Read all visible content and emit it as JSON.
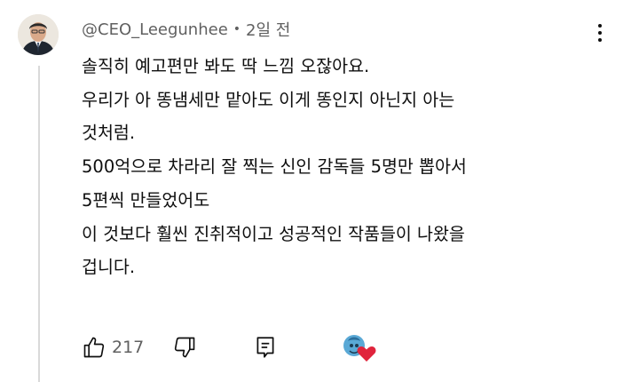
{
  "comment": {
    "author_handle": "@CEO_Leegunhee",
    "separator": "•",
    "timestamp": "2일 전",
    "lines": [
      "솔직히 예고편만 봐도 딱 느낌 오잖아요.",
      "우리가 아 똥냄세만 맡아도 이게 똥인지 아닌지 아는",
      "것처럼.",
      "500억으로 차라리 잘 찍는 신인 감독들 5명만 뽑아서",
      "5편씩 만들었어도",
      "이 것보다 훨씬 진취적이고 성공적인 작품들이 나왔을",
      "겁니다."
    ],
    "like_count": "217"
  },
  "icons": {
    "more": "more-vertical-icon",
    "like": "thumbs-up-icon",
    "dislike": "thumbs-down-icon",
    "reply": "reply-icon",
    "creator_heart": "creator-heart-icon"
  },
  "colors": {
    "text": "#0f0f0f",
    "meta": "#606060",
    "heart": "#e0243c",
    "thread_line": "#d9d9d9"
  }
}
